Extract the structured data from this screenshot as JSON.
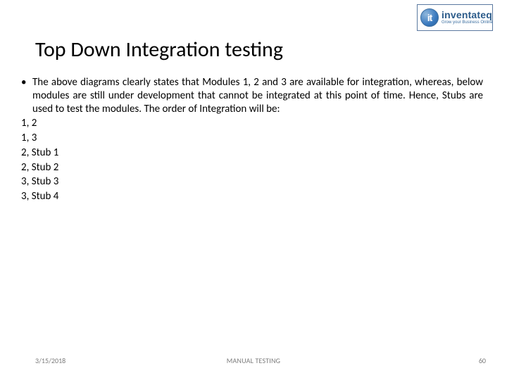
{
  "logo": {
    "badge_text": "it",
    "brand": "inventateq",
    "tagline": "Grow your Business Online"
  },
  "title": "Top Down Integration testing",
  "bullet_text": "The above diagrams clearly states that Modules 1, 2 and 3 are available for integration, whereas, below modules are still under development that cannot be integrated at this point of time. Hence, Stubs are used to test the modules. The order of Integration will be:",
  "lines": [
    "1, 2",
    "1, 3",
    "2, Stub 1",
    "2, Stub 2",
    "3, Stub 3",
    "3, Stub 4"
  ],
  "footer": {
    "date": "3/15/2018",
    "center": "MANUAL TESTING",
    "page": "60"
  }
}
